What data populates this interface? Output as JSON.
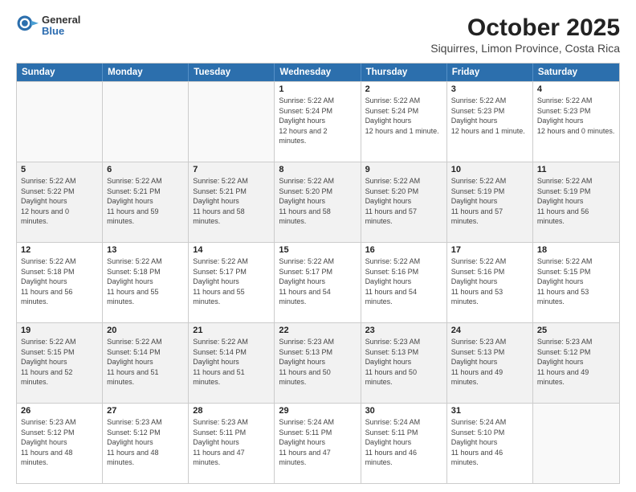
{
  "header": {
    "logo": {
      "general": "General",
      "blue": "Blue"
    },
    "title": "October 2025",
    "subtitle": "Siquirres, Limon Province, Costa Rica"
  },
  "calendar": {
    "days_of_week": [
      "Sunday",
      "Monday",
      "Tuesday",
      "Wednesday",
      "Thursday",
      "Friday",
      "Saturday"
    ],
    "rows": [
      [
        {
          "day": "",
          "empty": true
        },
        {
          "day": "",
          "empty": true
        },
        {
          "day": "",
          "empty": true
        },
        {
          "day": "1",
          "sunrise": "5:22 AM",
          "sunset": "5:24 PM",
          "daylight": "12 hours and 2 minutes."
        },
        {
          "day": "2",
          "sunrise": "5:22 AM",
          "sunset": "5:24 PM",
          "daylight": "12 hours and 1 minute."
        },
        {
          "day": "3",
          "sunrise": "5:22 AM",
          "sunset": "5:23 PM",
          "daylight": "12 hours and 1 minute."
        },
        {
          "day": "4",
          "sunrise": "5:22 AM",
          "sunset": "5:23 PM",
          "daylight": "12 hours and 0 minutes."
        }
      ],
      [
        {
          "day": "5",
          "sunrise": "5:22 AM",
          "sunset": "5:22 PM",
          "daylight": "12 hours and 0 minutes."
        },
        {
          "day": "6",
          "sunrise": "5:22 AM",
          "sunset": "5:21 PM",
          "daylight": "11 hours and 59 minutes."
        },
        {
          "day": "7",
          "sunrise": "5:22 AM",
          "sunset": "5:21 PM",
          "daylight": "11 hours and 58 minutes."
        },
        {
          "day": "8",
          "sunrise": "5:22 AM",
          "sunset": "5:20 PM",
          "daylight": "11 hours and 58 minutes."
        },
        {
          "day": "9",
          "sunrise": "5:22 AM",
          "sunset": "5:20 PM",
          "daylight": "11 hours and 57 minutes."
        },
        {
          "day": "10",
          "sunrise": "5:22 AM",
          "sunset": "5:19 PM",
          "daylight": "11 hours and 57 minutes."
        },
        {
          "day": "11",
          "sunrise": "5:22 AM",
          "sunset": "5:19 PM",
          "daylight": "11 hours and 56 minutes."
        }
      ],
      [
        {
          "day": "12",
          "sunrise": "5:22 AM",
          "sunset": "5:18 PM",
          "daylight": "11 hours and 56 minutes."
        },
        {
          "day": "13",
          "sunrise": "5:22 AM",
          "sunset": "5:18 PM",
          "daylight": "11 hours and 55 minutes."
        },
        {
          "day": "14",
          "sunrise": "5:22 AM",
          "sunset": "5:17 PM",
          "daylight": "11 hours and 55 minutes."
        },
        {
          "day": "15",
          "sunrise": "5:22 AM",
          "sunset": "5:17 PM",
          "daylight": "11 hours and 54 minutes."
        },
        {
          "day": "16",
          "sunrise": "5:22 AM",
          "sunset": "5:16 PM",
          "daylight": "11 hours and 54 minutes."
        },
        {
          "day": "17",
          "sunrise": "5:22 AM",
          "sunset": "5:16 PM",
          "daylight": "11 hours and 53 minutes."
        },
        {
          "day": "18",
          "sunrise": "5:22 AM",
          "sunset": "5:15 PM",
          "daylight": "11 hours and 53 minutes."
        }
      ],
      [
        {
          "day": "19",
          "sunrise": "5:22 AM",
          "sunset": "5:15 PM",
          "daylight": "11 hours and 52 minutes."
        },
        {
          "day": "20",
          "sunrise": "5:22 AM",
          "sunset": "5:14 PM",
          "daylight": "11 hours and 51 minutes."
        },
        {
          "day": "21",
          "sunrise": "5:22 AM",
          "sunset": "5:14 PM",
          "daylight": "11 hours and 51 minutes."
        },
        {
          "day": "22",
          "sunrise": "5:23 AM",
          "sunset": "5:13 PM",
          "daylight": "11 hours and 50 minutes."
        },
        {
          "day": "23",
          "sunrise": "5:23 AM",
          "sunset": "5:13 PM",
          "daylight": "11 hours and 50 minutes."
        },
        {
          "day": "24",
          "sunrise": "5:23 AM",
          "sunset": "5:13 PM",
          "daylight": "11 hours and 49 minutes."
        },
        {
          "day": "25",
          "sunrise": "5:23 AM",
          "sunset": "5:12 PM",
          "daylight": "11 hours and 49 minutes."
        }
      ],
      [
        {
          "day": "26",
          "sunrise": "5:23 AM",
          "sunset": "5:12 PM",
          "daylight": "11 hours and 48 minutes."
        },
        {
          "day": "27",
          "sunrise": "5:23 AM",
          "sunset": "5:12 PM",
          "daylight": "11 hours and 48 minutes."
        },
        {
          "day": "28",
          "sunrise": "5:23 AM",
          "sunset": "5:11 PM",
          "daylight": "11 hours and 47 minutes."
        },
        {
          "day": "29",
          "sunrise": "5:24 AM",
          "sunset": "5:11 PM",
          "daylight": "11 hours and 47 minutes."
        },
        {
          "day": "30",
          "sunrise": "5:24 AM",
          "sunset": "5:11 PM",
          "daylight": "11 hours and 46 minutes."
        },
        {
          "day": "31",
          "sunrise": "5:24 AM",
          "sunset": "5:10 PM",
          "daylight": "11 hours and 46 minutes."
        },
        {
          "day": "",
          "empty": true
        }
      ]
    ]
  },
  "labels": {
    "sunrise": "Sunrise:",
    "sunset": "Sunset:",
    "daylight": "Daylight hours"
  }
}
